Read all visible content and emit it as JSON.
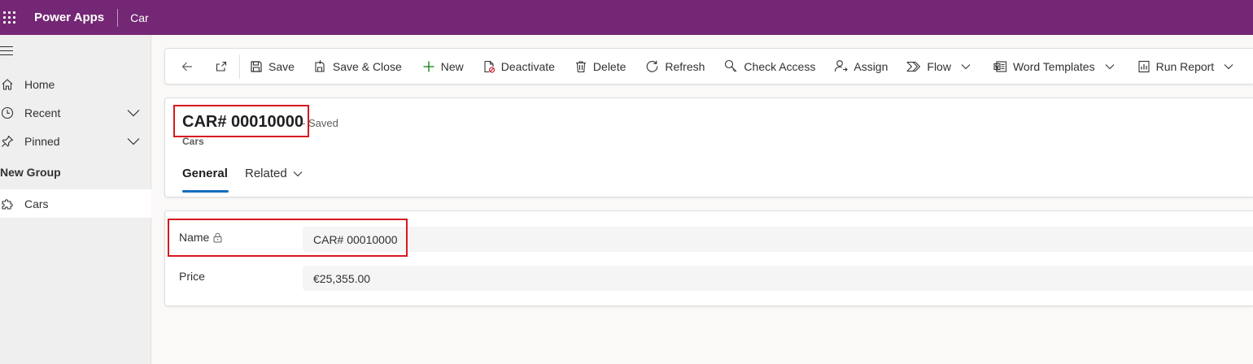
{
  "header": {
    "app_name": "Power Apps",
    "entity": "Car"
  },
  "sidebar": {
    "items": [
      {
        "label": "Home",
        "icon": "home-icon"
      },
      {
        "label": "Recent",
        "icon": "clock-icon"
      },
      {
        "label": "Pinned",
        "icon": "pin-icon"
      }
    ],
    "group_label": "New Group",
    "group_items": [
      {
        "label": "Cars",
        "icon": "puzzle-icon",
        "selected": true
      }
    ]
  },
  "commands": {
    "save": "Save",
    "save_close": "Save & Close",
    "new": "New",
    "deactivate": "Deactivate",
    "delete": "Delete",
    "refresh": "Refresh",
    "check_access": "Check Access",
    "assign": "Assign",
    "flow": "Flow",
    "word_templates": "Word Templates",
    "run_report": "Run Report"
  },
  "record": {
    "title": "CAR# 00010000",
    "status": "- Saved",
    "entity_label": "Cars"
  },
  "tabs": {
    "general": "General",
    "related": "Related"
  },
  "form": {
    "fields": [
      {
        "label": "Name",
        "value": "CAR# 00010000",
        "locked": true
      },
      {
        "label": "Price",
        "value": "€25,355.00",
        "locked": false
      }
    ]
  },
  "colors": {
    "header_bg": "#742774",
    "highlight": "#d71920",
    "tab_accent": "#0f6cbd",
    "new_icon": "#107c10"
  }
}
